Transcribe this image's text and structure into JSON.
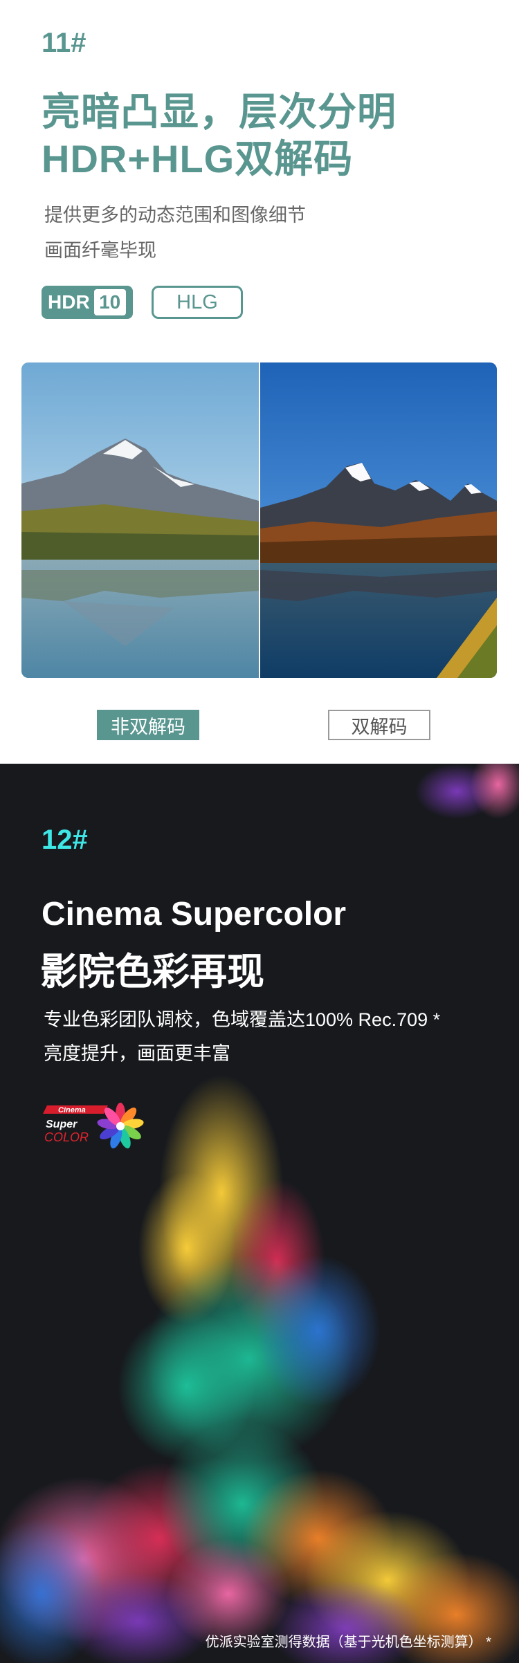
{
  "section11": {
    "number": "11#",
    "title_line1": "亮暗凸显，层次分明",
    "title_line2": "HDR+HLG双解码",
    "desc_line1": "提供更多的动态范围和图像细节",
    "desc_line2": "画面纤毫毕现",
    "badge_hdr10": {
      "left": "HDR",
      "right": "10"
    },
    "badge_hlg": "HLG",
    "label_left": "非双解码",
    "label_right": "双解码"
  },
  "section12": {
    "number": "12#",
    "title_en": "Cinema Supercolor",
    "title_cn": "影院色彩再现",
    "desc_line1": "专业色彩团队调校，色域覆盖达100% Rec.709 *",
    "desc_line2": "亮度提升，画面更丰富",
    "logo": {
      "line1": "Cinema",
      "line2": "Super",
      "line3": "COLOR"
    },
    "footnote": "优派实验室测得数据（基于光机色坐标测算） *"
  },
  "colors": {
    "accent_teal": "#5a9690",
    "accent_cyan": "#3fe6e6",
    "dark_bg": "#17191d"
  }
}
